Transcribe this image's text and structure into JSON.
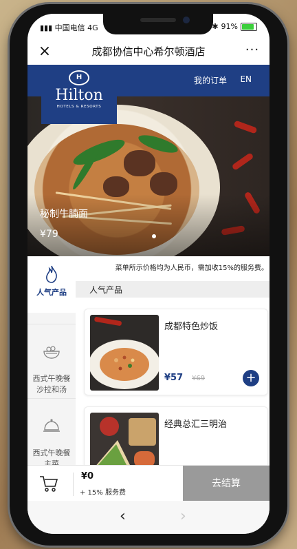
{
  "status": {
    "carrier": "中国电信",
    "network": "4G",
    "battery": "91%",
    "battery_level": 0.91
  },
  "header": {
    "title": "成都协信中心希尔顿酒店",
    "close": "×",
    "more": "···"
  },
  "brand": {
    "logo_mark": "H",
    "logo_name": "Hilton",
    "logo_sub": "HOTELS & RESORTS",
    "orders": "我的订单",
    "language": "EN",
    "color": "#1f3f84"
  },
  "hero": {
    "caption": "秘制牛腩面",
    "price": "¥79"
  },
  "notice": "菜单所示价格均为人民币，需加收15%的服务费。",
  "sidebar": {
    "items": [
      {
        "label": "人气产品",
        "icon": "flame-icon",
        "active": true
      },
      {
        "label": "西式午晚餐\n沙拉和汤",
        "icon": "salad-bowl-icon",
        "active": false
      },
      {
        "label": "西式午晚餐\n主菜",
        "icon": "cloche-icon",
        "active": false
      }
    ]
  },
  "section": {
    "title": "人气产品"
  },
  "products": [
    {
      "name": "成都特色炒饭",
      "price": "¥57",
      "old_price": "¥69",
      "add": "+"
    },
    {
      "name": "经典总汇三明治",
      "price": "",
      "old_price": "",
      "add": ""
    }
  ],
  "cart": {
    "total": "¥0",
    "fee": "+ 15% 服务费",
    "checkout": "去结算"
  },
  "nav": {
    "back": "‹",
    "forward": "›"
  }
}
